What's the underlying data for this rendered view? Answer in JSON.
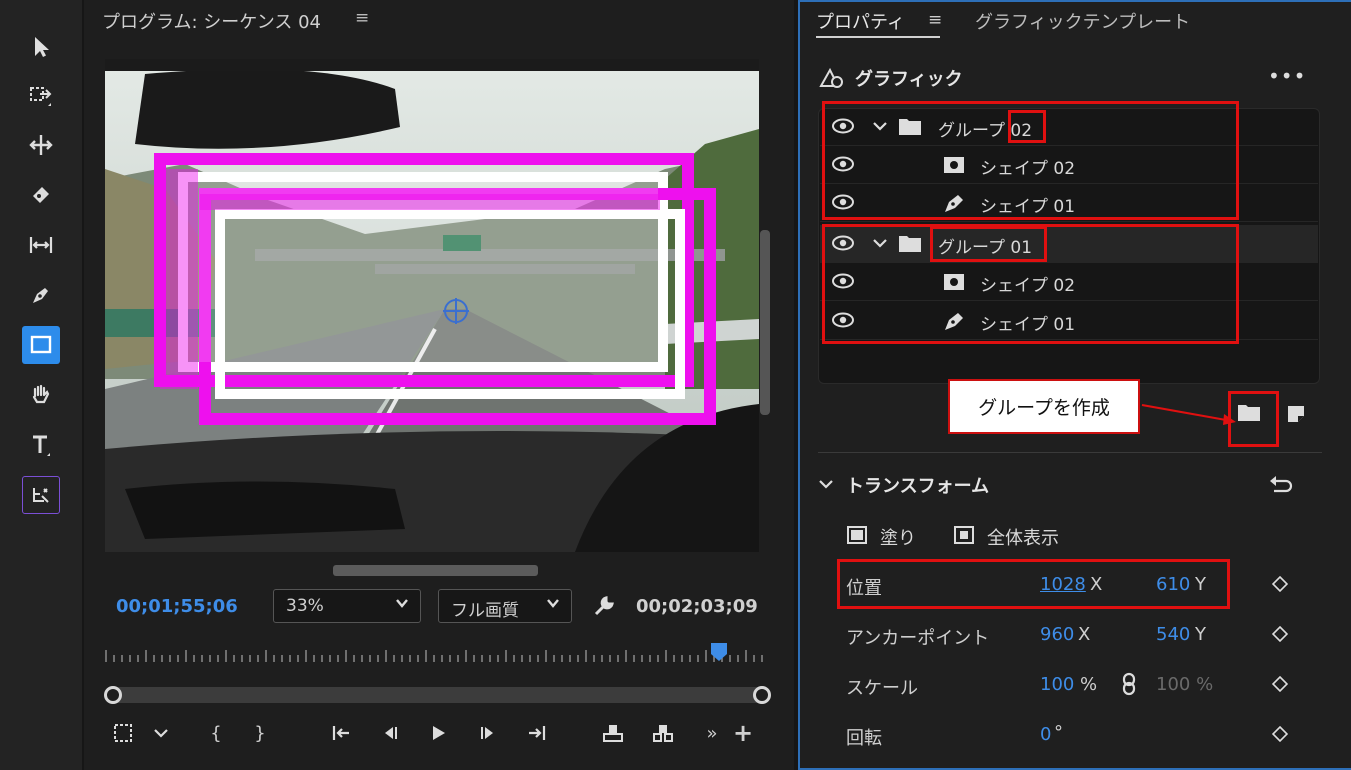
{
  "toolbar": {
    "tools": [
      "selection-tool",
      "track-select-tool",
      "ripple-edit-tool",
      "razor-tool",
      "slip-tool",
      "pen-tool",
      "rectangle-tool",
      "hand-tool",
      "type-tool",
      "essential-graphics-tool"
    ],
    "active": "rectangle-tool"
  },
  "monitor": {
    "title": "プログラム: シーケンス 04",
    "menu_icon": "≡",
    "current_timecode": "00;01;55;06",
    "duration_timecode": "00;02;03;09",
    "zoom": "33%",
    "quality": "フル画質",
    "colors": {
      "timecode": "#3e8de8",
      "magenta": "#ee10ee"
    }
  },
  "controls": {
    "labels": [
      "{",
      "}"
    ],
    "more": "»",
    "add": "+"
  },
  "properties": {
    "tab_active": "プロパティ",
    "tab_menu": "≡",
    "tab_other": "グラフィックテンプレート",
    "graphic_title": "グラフィック",
    "more": "•••",
    "layers": [
      {
        "name_prefix": "グループ ",
        "name_suffix": "02",
        "type": "group"
      },
      {
        "name": "シェイプ 02",
        "type": "shape"
      },
      {
        "name": "シェイプ 01",
        "type": "path"
      },
      {
        "name": "グループ 01",
        "type": "group"
      },
      {
        "name": "シェイプ 02",
        "type": "shape"
      },
      {
        "name": "シェイプ 01",
        "type": "path"
      }
    ],
    "callout": "グループを作成",
    "transform": {
      "title": "トランスフォーム",
      "fill_label": "塗り",
      "fit_label": "全体表示",
      "position": {
        "label": "位置",
        "x": "1028",
        "y": "610"
      },
      "anchor": {
        "label": "アンカーポイント",
        "x": "960",
        "y": "540"
      },
      "scale": {
        "label": "スケール",
        "value": "100",
        "unit": "%",
        "value2": "100 %"
      },
      "rotation": {
        "label": "回転",
        "value": "0",
        "unit": "°"
      }
    },
    "axis_x": "X",
    "axis_y": "Y",
    "colors": {
      "accent": "#3e8de8",
      "highlight": "#e01010",
      "panel_border": "#2d6fb8"
    }
  }
}
